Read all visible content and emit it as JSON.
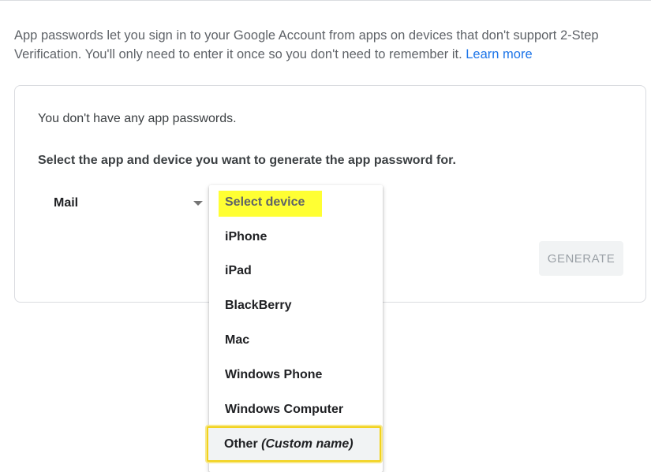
{
  "intro": {
    "text": "App passwords let you sign in to your Google Account from apps on devices that don't support 2-Step Verification. You'll only need to enter it once so you don't need to remember it.",
    "learn_more": "Learn more"
  },
  "card": {
    "no_passwords": "You don't have any app passwords.",
    "instruction": "Select the app and device you want to generate the app password for.",
    "app_select_value": "Mail",
    "generate_label": "GENERATE"
  },
  "device_menu": {
    "placeholder": "Select device",
    "items": [
      "iPhone",
      "iPad",
      "BlackBerry",
      "Mac",
      "Windows Phone",
      "Windows Computer"
    ],
    "other_label": "Other",
    "other_hint": "(Custom name)"
  },
  "colors": {
    "link": "#1a73e8",
    "highlight": "#ffff33",
    "focus_border": "#f2d21b"
  }
}
